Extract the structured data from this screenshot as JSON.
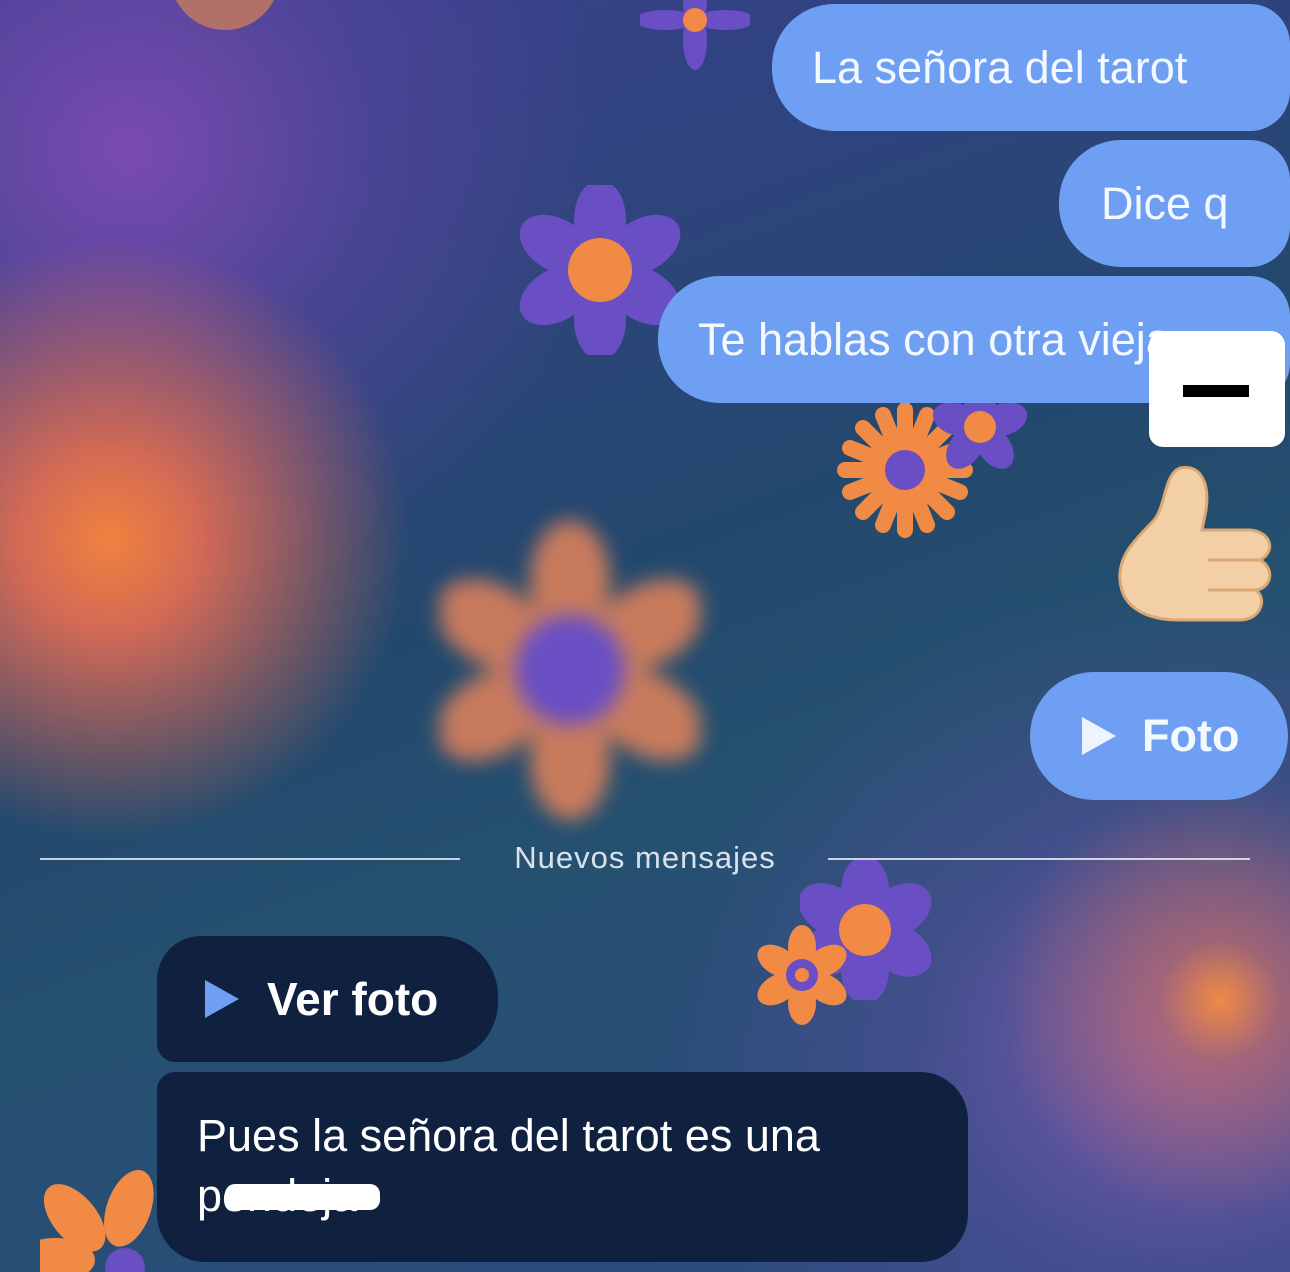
{
  "chat": {
    "outgoing": [
      {
        "text": "La señora del tarot"
      },
      {
        "text": "Dice q"
      },
      {
        "text": "Te hablas con otra vieja"
      }
    ],
    "reaction_emoji": "👍",
    "photo_sent": {
      "icon": "play-icon",
      "label": "Foto"
    },
    "new_messages_divider": "Nuevos mensajes",
    "photo_received": {
      "icon": "play-icon",
      "label": "Ver foto"
    },
    "incoming_text": {
      "line1": "Pues la señora del tarot es una",
      "line2": "pendeja"
    }
  },
  "colors": {
    "outgoing_bubble": "#6f9ff3",
    "incoming_bubble": "#10203f",
    "flower_orange": "#f08a45",
    "flower_purple": "#6a4fc4"
  }
}
